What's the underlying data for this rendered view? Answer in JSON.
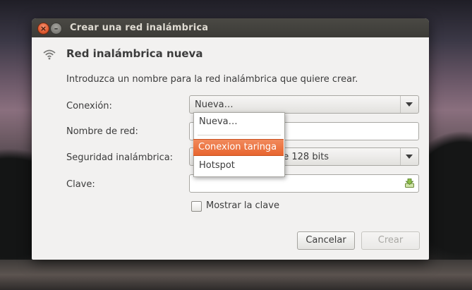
{
  "window": {
    "title": "Crear una red inalámbrica",
    "close_glyph": "×",
    "minimize_glyph": "–"
  },
  "dialog": {
    "header_title": "Red inalámbrica nueva",
    "intro_text": "Introduzca un nombre para la red inalámbrica que quiere crear.",
    "fields": {
      "connection_label": "Conexión:",
      "connection_value": "Nueva…",
      "network_name_label": "Nombre de red:",
      "network_name_value": "",
      "security_label": "Seguridad inalámbrica:",
      "security_value": "de 128 bits",
      "key_label": "Clave:",
      "key_value": ""
    },
    "show_key_checkbox": {
      "label": "Mostrar la clave",
      "checked": false
    },
    "buttons": {
      "cancel": "Cancelar",
      "create": "Crear"
    }
  },
  "connection_dropdown": {
    "options": [
      "Nueva…",
      "Conexion taringa",
      "Hotspot"
    ],
    "highlighted": "Conexion taringa"
  },
  "colors": {
    "accent": "#e8652f",
    "titlebar": "#3c3b37",
    "dialog_bg": "#f2f1f0"
  },
  "icons": {
    "header": "wifi-icon",
    "key_field": "keyboard-input-icon"
  }
}
